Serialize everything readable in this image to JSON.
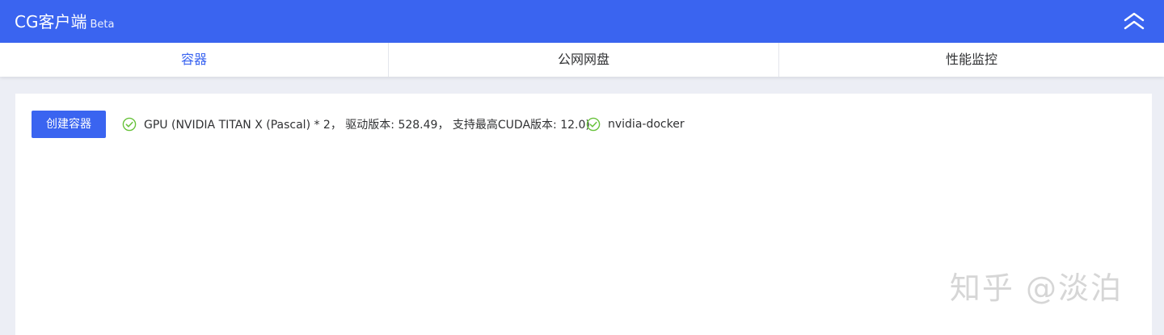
{
  "header": {
    "title": "CG客户端",
    "badge": "Beta",
    "collapse_icon": "double-chevron-up-icon",
    "background": "#3a64f0"
  },
  "tabs": [
    {
      "label": "容器",
      "active": true
    },
    {
      "label": "公网网盘",
      "active": false
    },
    {
      "label": "性能监控",
      "active": false
    }
  ],
  "main": {
    "create_button": "创建容器",
    "statuses": [
      {
        "icon": "check-circle-icon",
        "text": "GPU (NVIDIA TITAN X (Pascal) * 2， 驱动版本: 528.49， 支持最高CUDA版本: 12.0)"
      },
      {
        "icon": "check-circle-icon",
        "text": "nvidia-docker"
      }
    ]
  },
  "watermark": "知乎 @淡泊",
  "colors": {
    "accent": "#3a64f0",
    "success": "#67c23a",
    "page_bg": "#eceef5"
  }
}
